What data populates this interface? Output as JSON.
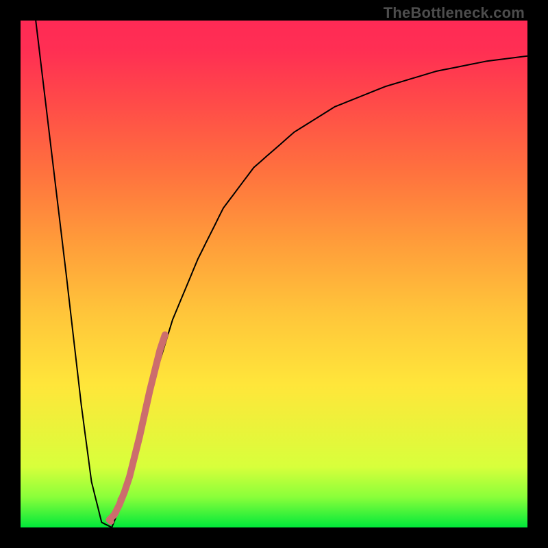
{
  "watermark": "TheBottleneck.com",
  "chart_data": {
    "type": "line",
    "title": "",
    "xlabel": "",
    "ylabel": "",
    "xlim": [
      0,
      100
    ],
    "ylim": [
      0,
      100
    ],
    "grid": false,
    "legend": false,
    "series": [
      {
        "name": "bottleneck-curve",
        "x": [
          3,
          6,
          9,
          12,
          14,
          16,
          18,
          20,
          23,
          26,
          30,
          35,
          40,
          46,
          54,
          62,
          72,
          82,
          92,
          100
        ],
        "y": [
          100,
          75,
          50,
          24,
          9,
          1,
          0,
          5,
          16,
          28,
          41,
          53,
          63,
          71,
          78,
          83,
          87,
          90,
          92,
          93
        ],
        "color": "#000000",
        "stroke_width": 2
      },
      {
        "name": "highlight-segment",
        "x": [
          17.5,
          18.5,
          19.5,
          20.5,
          21.5,
          22.5,
          23.5,
          24.5,
          25.5,
          26.5,
          27.5,
          28.5
        ],
        "y": [
          1.5,
          2.5,
          4.5,
          7,
          10,
          14,
          18,
          22.5,
          27,
          31,
          35,
          38
        ],
        "color": "#cc6d6d",
        "stroke_width": 10,
        "linecap": "round"
      }
    ],
    "markers": [
      {
        "name": "dot-a",
        "x": 17.8,
        "y": 1.2,
        "r": 5,
        "color": "#cc6d6d"
      },
      {
        "name": "dot-b",
        "x": 18.8,
        "y": 3.0,
        "r": 5,
        "color": "#cc6d6d"
      },
      {
        "name": "dot-c",
        "x": 19.8,
        "y": 5.5,
        "r": 5,
        "color": "#cc6d6d"
      }
    ]
  }
}
